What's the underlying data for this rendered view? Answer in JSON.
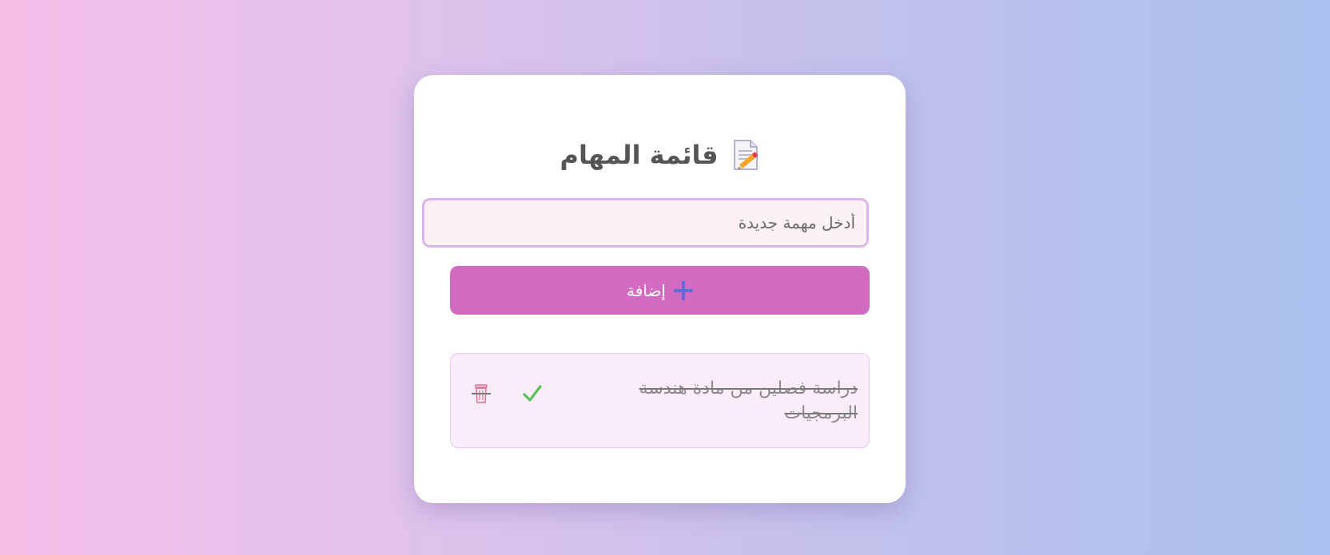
{
  "header": {
    "title": "قائمة المهام",
    "title_icon": "memo-icon"
  },
  "form": {
    "input_placeholder": "أدخل مهمة جديدة",
    "input_value": "",
    "add_label": "إضافة",
    "add_icon": "plus-icon"
  },
  "tasks": [
    {
      "text": "دراسة فصلين من مادة هندسة البرمجيات",
      "completed": true,
      "complete_icon": "checkmark-icon",
      "delete_icon": "trash-icon"
    }
  ],
  "colors": {
    "background_start": "#f6bfe8",
    "background_end": "#aac0ee",
    "card": "#ffffff",
    "button": "#d36bc2",
    "input_border": "#dcb7e6",
    "input_background": "#fdf1f6",
    "task_background": "#fbecf9",
    "check": "#5cc05c",
    "trash": "#e06b8a"
  }
}
